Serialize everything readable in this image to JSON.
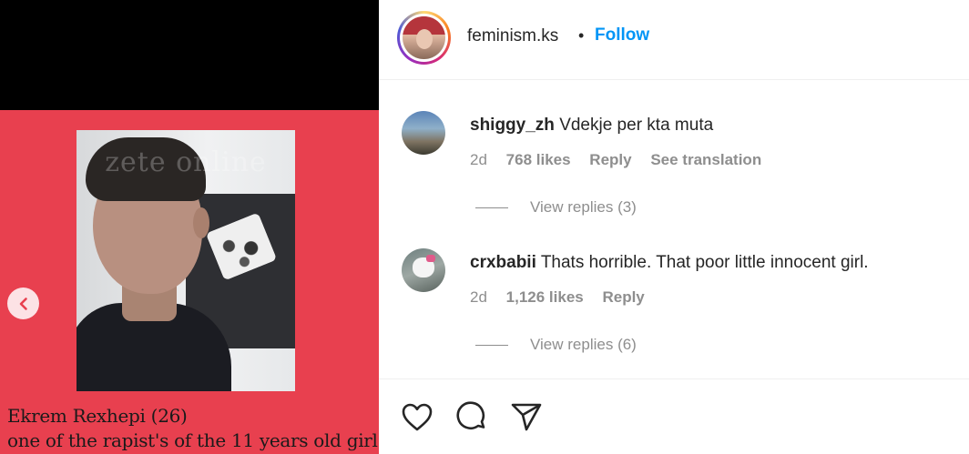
{
  "post": {
    "caption_line1": "Ekrem Rexhepi (26)",
    "caption_line2": "one of the rapist's of the 11 years old girl",
    "watermark": "zete online",
    "card_color": "#e8404f"
  },
  "header": {
    "username": "feminism.ks",
    "separator": "•",
    "follow_label": "Follow",
    "accent_color": "#0095f6"
  },
  "comments": [
    {
      "username": "shiggy_zh",
      "text": "Vdekje per kta muta",
      "age": "2d",
      "likes": "768 likes",
      "reply_label": "Reply",
      "translate_label": "See translation",
      "view_replies": "View replies (3)"
    },
    {
      "username": "crxbabii",
      "text": "Thats horrible. That poor little innocent girl.",
      "age": "2d",
      "likes": "1,126 likes",
      "reply_label": "Reply",
      "view_replies": "View replies (6)"
    }
  ],
  "actions": {
    "like_icon": "heart-icon",
    "comment_icon": "comment-icon",
    "share_icon": "share-icon"
  }
}
